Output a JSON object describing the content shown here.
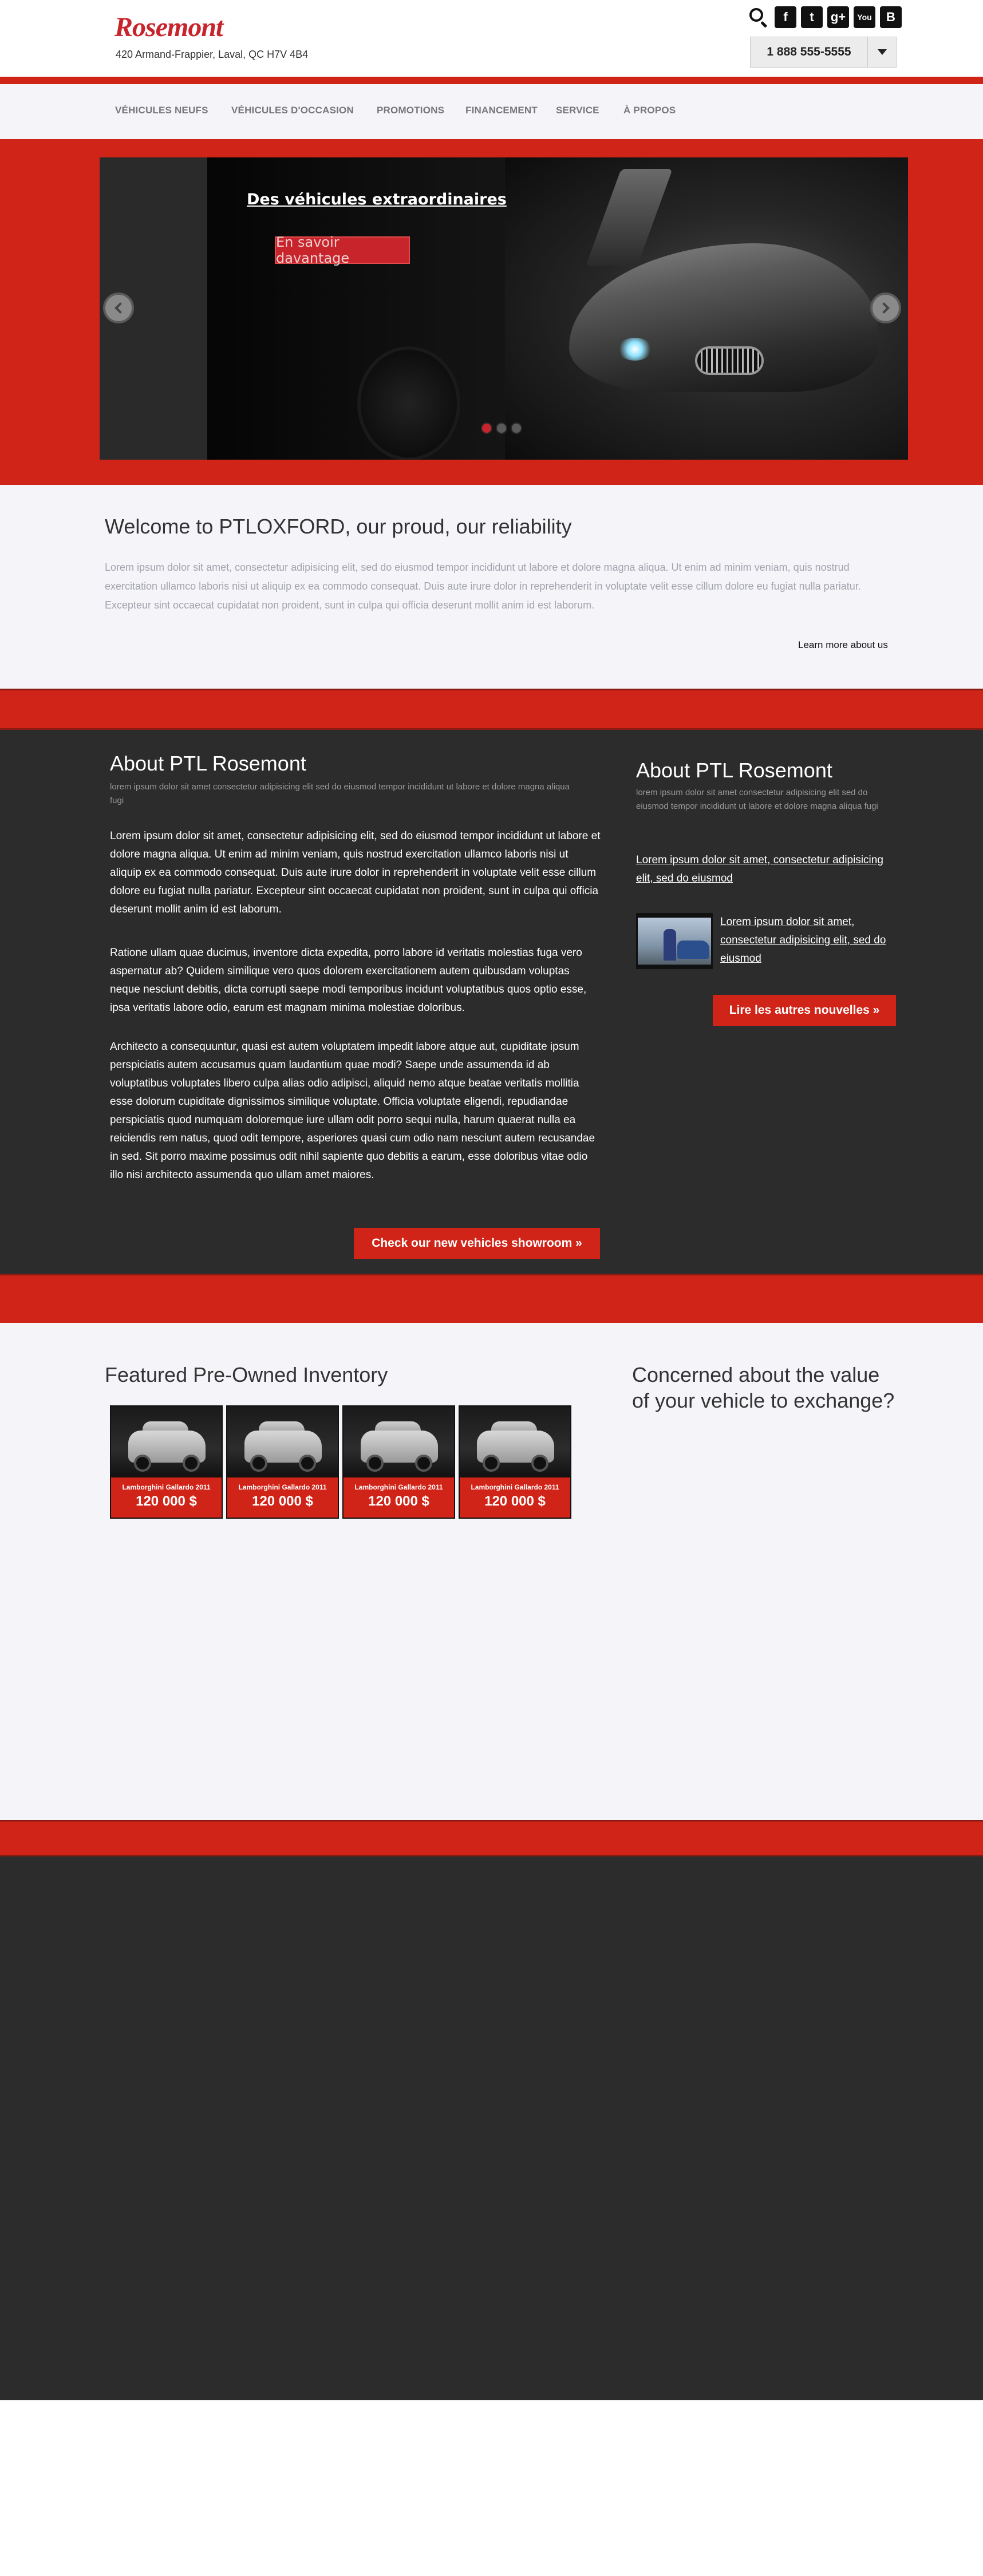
{
  "header": {
    "logo": "Rosemont",
    "address": "420 Armand-Frappier, Laval, QC  H7V 4B4",
    "phone": "1 888 555-5555",
    "social_icons": [
      "facebook-icon",
      "twitter-icon",
      "google-plus-icon",
      "youtube-icon",
      "blogger-icon"
    ]
  },
  "nav": {
    "items": [
      "VÉHICULES NEUFS",
      "VÉHICULES D'OCCASION",
      "PROMOTIONS",
      "FINANCEMENT",
      "SERVICE",
      "À PROPOS"
    ]
  },
  "hero": {
    "title": "Des véhicules extraordinaires",
    "button": "En savoir davantage",
    "slides": 3,
    "active_slide": 1
  },
  "welcome": {
    "title": "Welcome to PTLOXFORD, our proud, our reliability",
    "body": "Lorem ipsum dolor sit amet, consectetur adipisicing elit, sed do eiusmod tempor incididunt ut labore et dolore magna aliqua. Ut enim ad minim veniam, quis nostrud exercitation ullamco laboris nisi ut aliquip ex ea commodo consequat. Duis aute irure dolor in reprehenderit in voluptate velit esse cillum dolore eu fugiat nulla pariatur. Excepteur sint occaecat cupidatat non proident, sunt in culpa qui officia deserunt mollit anim id est laborum.",
    "more_link": "Learn more about us"
  },
  "about": {
    "title": "About PTL Rosemont",
    "subtitle": "lorem ipsum dolor sit amet consectetur adipisicing elit sed do eiusmod tempor incididunt ut labore et dolore magna aliqua fugi",
    "paragraphs": [
      "Lorem ipsum dolor sit amet, consectetur adipisicing elit, sed do eiusmod tempor incididunt ut labore et dolore magna aliqua. Ut enim ad minim veniam, quis nostrud exercitation ullamco laboris nisi ut aliquip ex ea commodo consequat. Duis aute irure dolor in reprehenderit in voluptate velit esse cillum dolore eu fugiat nulla pariatur. Excepteur sint occaecat cupidatat non proident, sunt in culpa qui officia deserunt mollit anim id est laborum.",
      "Ratione ullam quae ducimus, inventore dicta expedita, porro labore id veritatis molestias fuga vero aspernatur ab? Quidem similique vero quos dolorem exercitationem autem quibusdam voluptas neque nesciunt debitis, dicta corrupti saepe modi temporibus incidunt voluptatibus quos optio esse, ipsa veritatis labore odio, earum est magnam minima molestiae doloribus.",
      "Architecto a consequuntur, quasi est autem voluptatem impedit labore atque aut, cupiditate ipsum perspiciatis autem accusamus quam laudantium quae modi? Saepe unde assumenda id ab voluptatibus voluptates libero culpa alias odio adipisci, aliquid nemo atque beatae veritatis mollitia esse dolorum cupiditate dignissimos similique voluptate. Officia voluptate eligendi, repudiandae perspiciatis quod numquam doloremque iure ullam odit porro sequi nulla, harum quaerat nulla ea reiciendis rem natus, quod odit tempore, asperiores quasi cum odio nam nesciunt autem recusandae in sed. Sit porro maxime possimus odit nihil sapiente quo debitis a earum, esse doloribus vitae odio illo nisi architecto assumenda quo ullam amet maiores."
    ],
    "showroom_button": "Check our new vehicles showroom »"
  },
  "sidebar": {
    "title": "About PTL Rosemont",
    "subtitle": "lorem ipsum dolor sit amet consectetur adipisicing elit sed do eiusmod tempor incididunt ut labore et dolore magna aliqua fugi",
    "link1": "Lorem ipsum dolor sit amet, consectetur adipisicing elit, sed do eiusmod",
    "link2": "Lorem ipsum dolor sit amet, consectetur adipisicing elit, sed do eiusmod",
    "news_button": "Lire les autres nouvelles »"
  },
  "featured": {
    "title": "Featured Pre-Owned Inventory",
    "cards": [
      {
        "name": "Lamborghini Gallardo 2011",
        "price": "120 000 $"
      },
      {
        "name": "Lamborghini Gallardo 2011",
        "price": "120 000 $"
      },
      {
        "name": "Lamborghini Gallardo 2011",
        "price": "120 000 $"
      },
      {
        "name": "Lamborghini Gallardo 2011",
        "price": "120 000 $"
      }
    ],
    "concern": "Concerned about the value of your vehicle to exchange?"
  },
  "colors": {
    "accent": "#d12418",
    "dark": "#2c2c2c",
    "light": "#f4f4f9"
  }
}
